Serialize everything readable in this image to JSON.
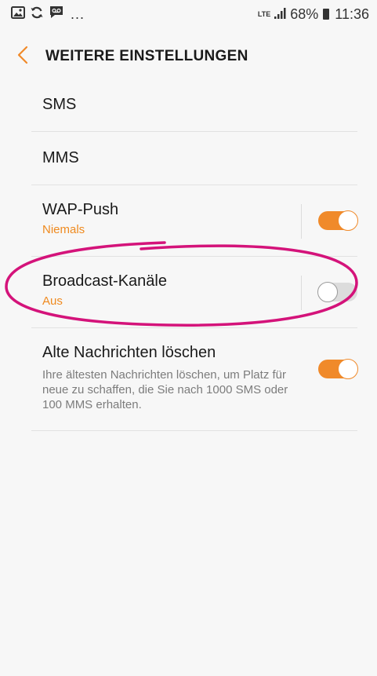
{
  "status_bar": {
    "left_icons": [
      "gallery-icon",
      "sync-icon",
      "voicemail-icon"
    ],
    "more": "...",
    "network": "LTE",
    "battery": "68%",
    "time": "11:36"
  },
  "header": {
    "title": "WEITERE EINSTELLUNGEN"
  },
  "settings": {
    "items": [
      {
        "title": "SMS"
      },
      {
        "title": "MMS"
      },
      {
        "title": "WAP-Push",
        "subtitle": "Niemals",
        "toggle": true
      },
      {
        "title": "Broadcast-Kanäle",
        "subtitle": "Aus",
        "toggle": false
      },
      {
        "title": "Alte Nachrichten löschen",
        "description": "Ihre ältesten Nachrichten löschen, um Platz für neue zu schaffen, die Sie nach 1000 SMS oder 100 MMS erhalten.",
        "toggle": true
      }
    ]
  },
  "colors": {
    "accent": "#f08a2a",
    "subtitle": "#ef8a1f",
    "highlight_ellipse": "#d4137a"
  }
}
